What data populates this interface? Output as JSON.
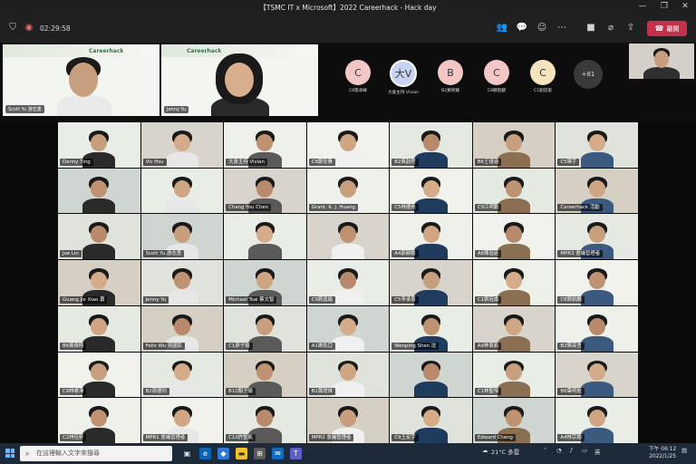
{
  "window": {
    "title": "【TSMC IT x Microsoft】2022 Careerhack - Hack day"
  },
  "toolbar": {
    "timer": "02:29:58",
    "leave_label": "離開"
  },
  "top_tiles": [
    {
      "name": "Scott Yu 游志勇"
    },
    {
      "name": "Jenny Yu"
    }
  ],
  "avatars": [
    {
      "initial": "C",
      "label": "C8張承峰",
      "color": "#f4c7c7"
    },
    {
      "initial": "大V",
      "label": "大會主持 Vivian",
      "color": "#c7d3f4"
    },
    {
      "initial": "B",
      "label": "B2黃筱臻",
      "color": "#f4c7c7"
    },
    {
      "initial": "C",
      "label": "C8鄭凱麟",
      "color": "#f4c7c7"
    },
    {
      "initial": "C",
      "label": "C1劉冠甫",
      "color": "#f4e3bd"
    }
  ],
  "more_count": "+81",
  "grid": [
    "Danny Ting",
    "Vic Hsu",
    "大會主持 Vivian",
    "C8鄭安雅",
    "B2黃韵程",
    "B6王瑾涵",
    "C5陳宇",
    "",
    "",
    "Chang You Chen",
    "Grant. K. J. Huang",
    "C5林德堯",
    "C9江明勳",
    "Careerhack 活動",
    "Joe Lin",
    "Scott Yu 游志勇",
    "",
    "",
    "A4郭耕暘",
    "A6陳冠廷",
    "MPR3 會議管理者",
    "Guang Jie Xiao 蕭",
    "Jenny Yu",
    "Michael Tsai 蔡文智",
    "C9劉嘉瑜",
    "C5李承恩",
    "C1劉冠甫",
    "C8鄭凱麟",
    "B6黃偉翔",
    "Felix Wu 吳國民",
    "C1廖子揚",
    "A1謝銘亞",
    "Wenping Shen 沈",
    "A9林東凱",
    "B2陳亮言",
    "C9林睿澤",
    "B2周德同",
    "B10顏子瑜",
    "B2蕭語姝",
    "",
    "C1林聖傑",
    "B6葉明航",
    "C2林佳軒",
    "MPR1 會議管理者",
    "C10許聖凱",
    "MPR2 會議管理者",
    "C9王宏宇",
    "Edward Cheng",
    "A4林宗翰"
  ],
  "taskbar": {
    "search_placeholder": "在這裡輸入文字來搜尋",
    "weather": "21°C 多雲",
    "ime": "英",
    "time": "下午 06:12",
    "date": "2022/1/25"
  }
}
